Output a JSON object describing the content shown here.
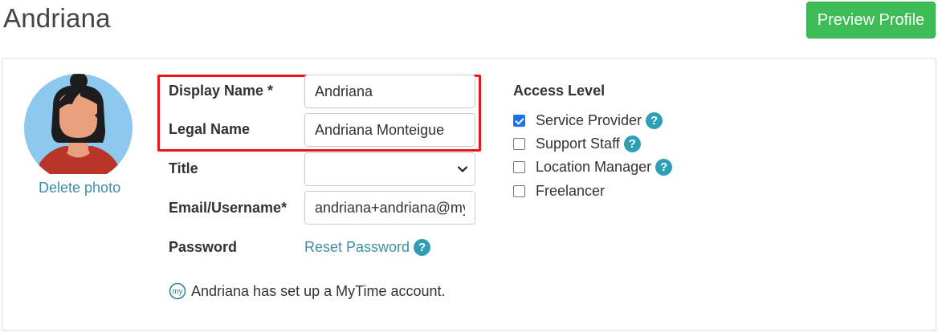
{
  "header": {
    "title": "Andriana",
    "preview_button": "Preview Profile"
  },
  "profile": {
    "delete_photo": "Delete photo"
  },
  "fields": {
    "display_name_label": "Display Name *",
    "display_name_value": "Andriana",
    "legal_name_label": "Legal Name",
    "legal_name_value": "Andriana Monteigue",
    "title_label": "Title",
    "title_value": "",
    "email_label": "Email/Username*",
    "email_value": "andriana+andriana@my",
    "password_label": "Password",
    "reset_password": "Reset Password"
  },
  "mytime": {
    "logo_text": "my",
    "message": "Andriana has set up a MyTime account."
  },
  "access": {
    "title": "Access Level",
    "items": [
      {
        "label": "Service Provider",
        "checked": true,
        "help": true
      },
      {
        "label": "Support Staff",
        "checked": false,
        "help": true
      },
      {
        "label": "Location Manager",
        "checked": false,
        "help": true
      },
      {
        "label": "Freelancer",
        "checked": false,
        "help": false
      }
    ]
  },
  "help_glyph": "?",
  "colors": {
    "primary_button": "#3dbb54",
    "link": "#3a8fa8",
    "help_icon": "#2f9fb6",
    "highlight": "#e8151b",
    "checkbox_checked": "#1a73e8"
  }
}
